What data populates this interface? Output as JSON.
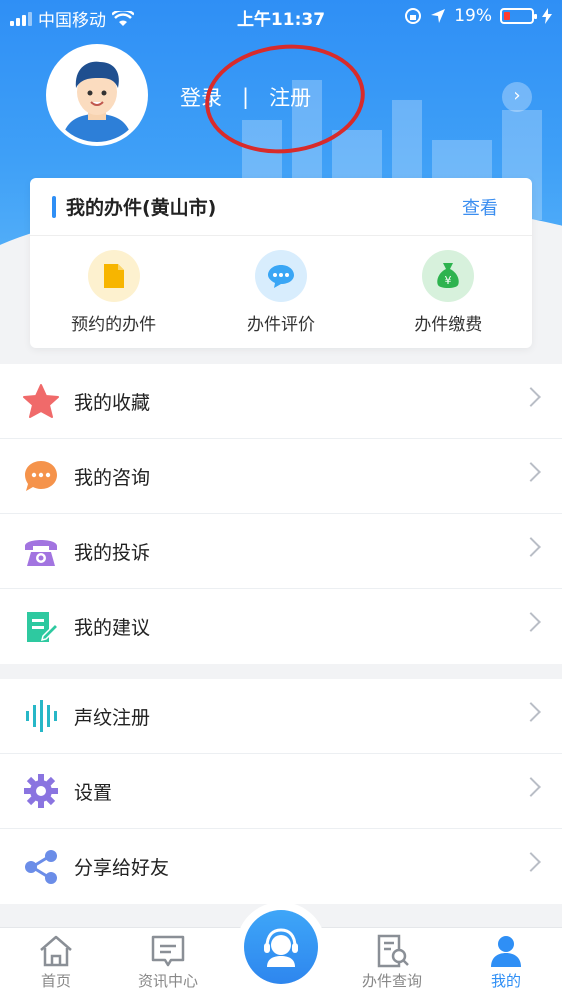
{
  "status_bar": {
    "carrier": "中国移动",
    "time": "上午11:37",
    "battery": "19%"
  },
  "profile": {
    "login_label": "登录",
    "divider": "|",
    "register_label": "注册"
  },
  "card": {
    "title": "我的办件(黄山市)",
    "link": "查看",
    "items": [
      {
        "label": "预约的办件",
        "icon": "document-icon",
        "color": "#f7b500"
      },
      {
        "label": "办件评价",
        "icon": "chat-bubble-icon",
        "color": "#3aa6f5"
      },
      {
        "label": "办件缴费",
        "icon": "money-bag-icon",
        "color": "#2eb34f"
      }
    ]
  },
  "list1": [
    {
      "label": "我的收藏",
      "icon": "star-icon",
      "color": "#f06a6a"
    },
    {
      "label": "我的咨询",
      "icon": "speech-bubble-icon",
      "color": "#f5934b"
    },
    {
      "label": "我的投诉",
      "icon": "phone-icon",
      "color": "#a274e0"
    },
    {
      "label": "我的建议",
      "icon": "suggestion-doc-icon",
      "color": "#2ec9a0"
    }
  ],
  "list2": [
    {
      "label": "声纹注册",
      "icon": "soundwave-icon",
      "color": "#27b7c7"
    },
    {
      "label": "设置",
      "icon": "gear-icon",
      "color": "#8a74e0"
    },
    {
      "label": "分享给好友",
      "icon": "share-icon",
      "color": "#6b8de8"
    }
  ],
  "tabs": [
    {
      "label": "首页",
      "icon": "home-icon"
    },
    {
      "label": "资讯中心",
      "icon": "news-icon"
    },
    {
      "label": "",
      "icon": "customer-service-icon"
    },
    {
      "label": "办件查询",
      "icon": "search-doc-icon"
    },
    {
      "label": "我的",
      "icon": "user-icon"
    }
  ],
  "colors": {
    "primary": "#2f8ff5",
    "annotation": "#d82b2b"
  }
}
